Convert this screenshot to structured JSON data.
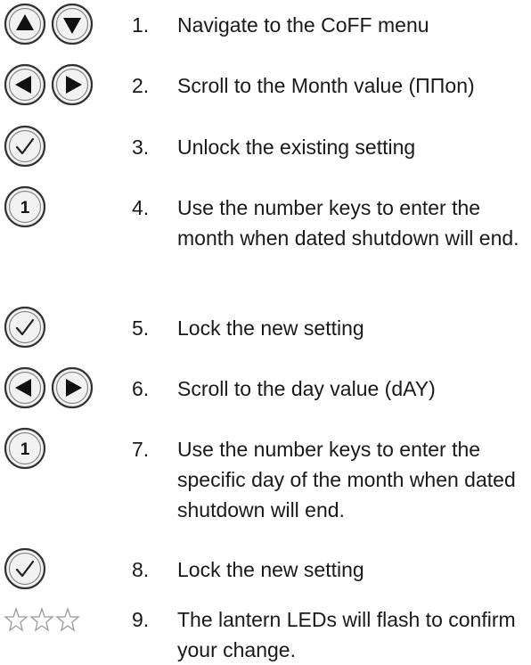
{
  "steps": [
    {
      "number": "1.",
      "text": "Navigate to the CoFF menu",
      "icons": [
        "up-arrow-button-icon",
        "down-arrow-button-icon"
      ]
    },
    {
      "number": "2.",
      "text": "Scroll to the Month value (ΠΠon)",
      "icons": [
        "left-arrow-button-icon",
        "right-arrow-button-icon"
      ]
    },
    {
      "number": "3.",
      "text": "Unlock the existing setting",
      "icons": [
        "checkmark-button-icon"
      ]
    },
    {
      "number": "4.",
      "text": "Use the number keys to enter the month when dated shutdown will end.",
      "icons": [
        "number-key-1-icon"
      ]
    },
    {
      "number": "5.",
      "text": "Lock the new setting",
      "icons": [
        "checkmark-button-icon"
      ]
    },
    {
      "number": "6.",
      "text": "Scroll to the day value (dAY)",
      "icons": [
        "left-arrow-button-icon",
        "right-arrow-button-icon"
      ]
    },
    {
      "number": "7.",
      "text": "Use the number keys to enter the specific day of the month when dated shutdown will end.",
      "icons": [
        "number-key-1-icon"
      ]
    },
    {
      "number": "8.",
      "text": "Lock the new setting",
      "icons": [
        "checkmark-button-icon"
      ]
    },
    {
      "number": "9.",
      "text": "The lantern LEDs will flash to confirm your change.",
      "icons": [
        "flashing-stars-icon"
      ]
    }
  ],
  "icon_key_label": "1"
}
